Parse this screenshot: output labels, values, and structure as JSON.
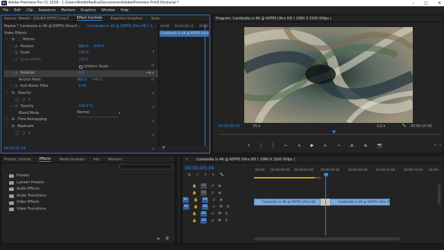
{
  "window": {
    "title": "Adobe Premiere Pro CC 2018 - C:\\Users\\RiddhiRadhu\\Documents\\Adobe\\Premiere Pro\\9.0\\tutorial *",
    "app_icon": "Pr"
  },
  "menu": [
    "File",
    "Edit",
    "Clip",
    "Sequence",
    "Markers",
    "Graphics",
    "Window",
    "Help"
  ],
  "source_panel": {
    "tabs": [
      {
        "label": "Source: Woosh - SOUND EFFECT.mp3"
      },
      {
        "label": "Effect Controls"
      },
      {
        "label": "Essential Graphics"
      },
      {
        "label": "Tools"
      }
    ],
    "master_label": "Master * Cambodia in 4K @ 60FPS Ultra H...",
    "seq_label": "Cambodia in 4K @ 60FPS Ultra HD ( 1...",
    "timecode_start": "00:00",
    "timecode_mid": "00:00:05:15",
    "timecode_end": "00:00",
    "mini_clip": "Cambodia in 4K @ 60FPS Ultra HD",
    "video_effects": "Video Effects",
    "motion": "Motion",
    "position": {
      "label": "Position",
      "x": "960.0",
      "y": "540.0"
    },
    "scale": {
      "label": "Scale",
      "value": "100.0"
    },
    "scale_width": {
      "label": "Scale Width",
      "value": "100.0"
    },
    "uniform_scale": "Uniform Scale",
    "rotation": {
      "label": "Rotation",
      "value": "0.0"
    },
    "anchor": {
      "label": "Anchor Point",
      "x": "960.0",
      "y": "540.0"
    },
    "anti_flicker": {
      "label": "Anti-flicker Filter",
      "value": "0.00"
    },
    "opacity": "Opacity",
    "opacity_value": {
      "label": "Opacity",
      "value": "100.0 %"
    },
    "blend": {
      "label": "Blend Mode",
      "value": "Normal"
    },
    "time_remap": "Time Remapping",
    "replicate": "Replicate",
    "current_time": "00:00:05:34"
  },
  "program_monitor": {
    "title": "Program: Cambodia in 4K @ 60FPS Ultra HD ( 1080 X 1920 60fps )",
    "current_time": "00:00:05:34",
    "fit": "Fit",
    "resolution": "1/2",
    "duration": "00:00:10:30"
  },
  "project_panel": {
    "tabs": [
      {
        "label": "Project: tutorial"
      },
      {
        "label": "Effects"
      },
      {
        "label": "Media Browser"
      },
      {
        "label": "Info"
      },
      {
        "label": "Markers"
      }
    ],
    "folders": [
      "Presets",
      "Lumetri Presets",
      "Audio Effects",
      "Audio Transitions",
      "Video Effects",
      "Video Transitions"
    ]
  },
  "timeline": {
    "tab": "Cambodia in 4K @ 60FPS Ultra HD ( 1080 X 1920 60fps )",
    "current_time": "00:00:05:34",
    "ruler": [
      "00:00",
      "00:00:02:00",
      "00:00:04:00",
      "00:00:06:00",
      "00:00:08:00",
      "00:00:10:00",
      "00:00:12:00",
      "00:00:"
    ],
    "video_tracks": [
      "V3",
      "V2",
      "V1"
    ],
    "audio_tracks": [
      "A1",
      "A2",
      "A3"
    ],
    "source_patch_v": "V1",
    "source_patch_a": "A1",
    "clip1": "Cambodia in 4K @ 60FPS Ultra HD",
    "clip2": "Cambodia in 4K @ 60FPS Ultra HD",
    "accent": "#2d8ceb",
    "clip_color": "#7faadf"
  }
}
